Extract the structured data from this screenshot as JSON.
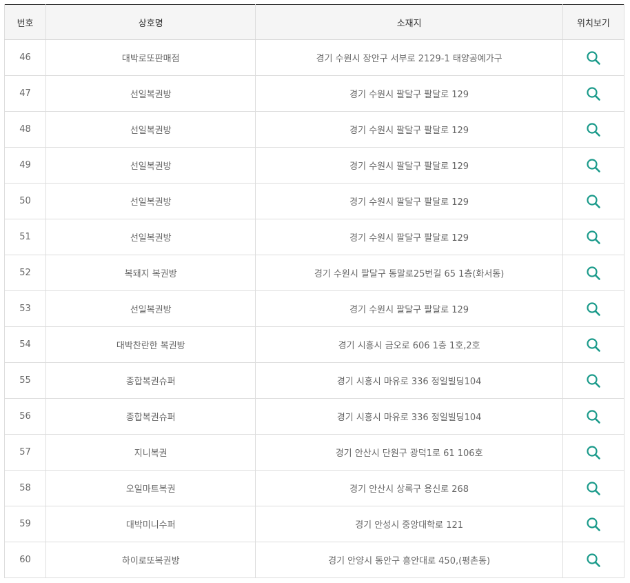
{
  "header": {
    "no": "번호",
    "name": "상호명",
    "address": "소재지",
    "location": "위치보기"
  },
  "colors": {
    "icon": "#1a9a8a",
    "border_top": "#333333"
  },
  "rows": [
    {
      "no": "46",
      "name": "대박로또판매점",
      "address": "경기 수원시 장안구 서부로 2129-1 태양공예가구",
      "icon": "search-icon"
    },
    {
      "no": "47",
      "name": "선일복권방",
      "address": "경기 수원시 팔달구 팔달로 129",
      "icon": "search-icon"
    },
    {
      "no": "48",
      "name": "선일복권방",
      "address": "경기 수원시 팔달구 팔달로 129",
      "icon": "search-icon"
    },
    {
      "no": "49",
      "name": "선일복권방",
      "address": "경기 수원시 팔달구 팔달로 129",
      "icon": "search-icon"
    },
    {
      "no": "50",
      "name": "선일복권방",
      "address": "경기 수원시 팔달구 팔달로 129",
      "icon": "search-icon"
    },
    {
      "no": "51",
      "name": "선일복권방",
      "address": "경기 수원시 팔달구 팔달로 129",
      "icon": "search-icon"
    },
    {
      "no": "52",
      "name": "복돼지 복권방",
      "address": "경기 수원시 팔달구 동말로25번길 65 1층(화서동)",
      "icon": "search-icon"
    },
    {
      "no": "53",
      "name": "선일복권방",
      "address": "경기 수원시 팔달구 팔달로 129",
      "icon": "search-icon"
    },
    {
      "no": "54",
      "name": "대박찬란한 복권방",
      "address": "경기 시흥시 금오로 606 1층 1호,2호",
      "icon": "search-icon"
    },
    {
      "no": "55",
      "name": "종합복권슈퍼",
      "address": "경기 시흥시 마유로 336 정일빌딩104",
      "icon": "search-icon"
    },
    {
      "no": "56",
      "name": "종합복권슈퍼",
      "address": "경기 시흥시 마유로 336 정일빌딩104",
      "icon": "search-icon"
    },
    {
      "no": "57",
      "name": "지니복권",
      "address": "경기 안산시 단원구 광덕1로 61 106호",
      "icon": "search-icon"
    },
    {
      "no": "58",
      "name": "오일마트복권",
      "address": "경기 안산시 상록구 용신로 268",
      "icon": "search-icon"
    },
    {
      "no": "59",
      "name": "대박미니수퍼",
      "address": "경기 안성시 중앙대학로 121",
      "icon": "search-icon"
    },
    {
      "no": "60",
      "name": "하이로또복권방",
      "address": "경기 안양시 동안구 흥안대로 450,(평촌동)",
      "icon": "search-icon"
    }
  ]
}
